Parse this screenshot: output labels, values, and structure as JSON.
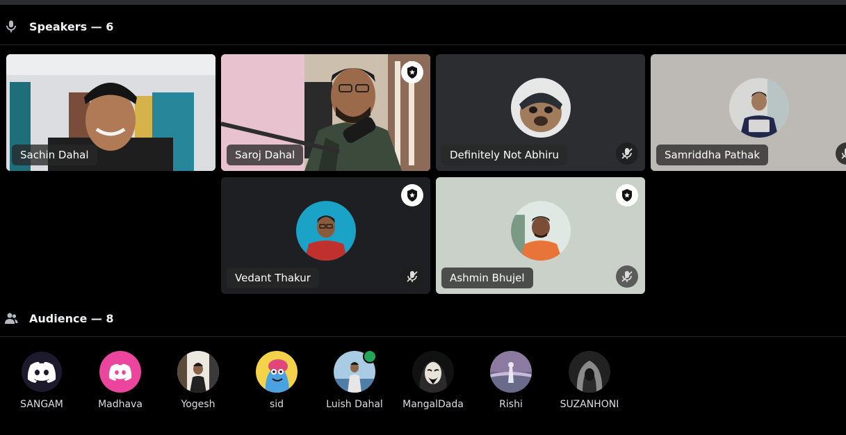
{
  "speakers_header": {
    "title": "Speakers — 6"
  },
  "audience_header": {
    "title": "Audience — 8"
  },
  "speakers": [
    {
      "name": "Sachin Dahal"
    },
    {
      "name": "Saroj Dahal"
    },
    {
      "name": "Definitely Not Abhiru"
    },
    {
      "name": "Samriddha Pathak"
    },
    {
      "name": "Vedant Thakur"
    },
    {
      "name": "Ashmin Bhujel"
    }
  ],
  "audience": [
    {
      "name": "SANGAM"
    },
    {
      "name": "Madhava"
    },
    {
      "name": "Yogesh"
    },
    {
      "name": "sid"
    },
    {
      "name": "Luish Dahal"
    },
    {
      "name": "MangalDada"
    },
    {
      "name": "Rishi"
    },
    {
      "name": "SUZANHONI"
    }
  ],
  "colors": {
    "speaking_outline": "#23a55a",
    "discord_blurple": "#5865f2",
    "discord_pink": "#eb459e"
  }
}
